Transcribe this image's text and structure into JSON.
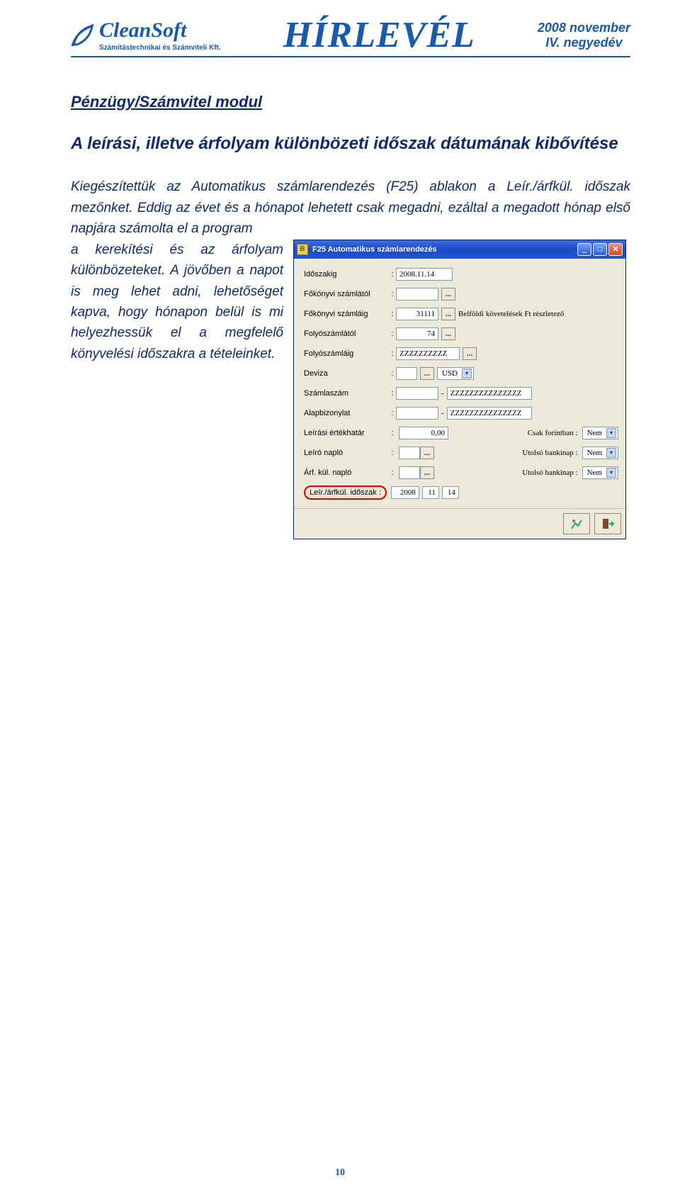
{
  "header": {
    "brand_name": "CleanSoft",
    "brand_sub": "Számítástechnikai és Számviteli Kft.",
    "newsletter_title": "HÍRLEVÉL",
    "date_line1": "2008 november",
    "date_line2": "IV. negyedév"
  },
  "module_title": "Pénzügy/Számvitel modul",
  "article_title": "A leírási, illetve árfolyam különbözeti időszak dátumának kibővítése",
  "paragraph_lead": "Kiegészítettük az ",
  "paragraph_em1": "Automatikus számlarendezés (F25)",
  "paragraph_mid1": " ablakon a ",
  "paragraph_em2": "Leír./árfkül. időszak",
  "paragraph_mid2": " mezőnket. Eddig az évet és a hónapot lehetett csak megadni, ezáltal a megadott hónap első napjára számolta el a program",
  "paragraph_left_tail": "a kerekítési és az árfolyam különbözeteket. A jövőben a napot is meg lehet adni, lehetőséget kapva, hogy hónapon belül is mi helyezhessük el a megfelelő könyvelési időszakra a tételeinket.",
  "dialog": {
    "title": "F25 Automatikus számlarendezés",
    "rows": {
      "idoszakig": {
        "label": "Időszakig",
        "value": "2008.11.14"
      },
      "fokonyvi_tol": {
        "label": "Főkönyvi számlától",
        "value": ""
      },
      "fokonyvi_ig": {
        "label": "Főkönyvi számláig",
        "value": "31111",
        "note": "Belföldi követelések Ft részletező"
      },
      "folyo_tol": {
        "label": "Folyószámlától",
        "value": "74"
      },
      "folyo_ig": {
        "label": "Folyószámláig",
        "value": "ZZZZZZZZZZ"
      },
      "deviza": {
        "label": "Deviza",
        "value": "USD"
      },
      "szamlaszam": {
        "label": "Számlaszám",
        "value": "ZZZZZZZZZZZZZZZ"
      },
      "alapbizonylat": {
        "label": "Alapbizonylat",
        "value": "ZZZZZZZZZZZZZZZ"
      },
      "ertekhatar": {
        "label": "Leírási értékhatár",
        "value": "0,00"
      },
      "csak_forint": {
        "label": "Csak forintban :",
        "value": "Nem"
      },
      "leiro_naplo": {
        "label": "Leíró napló",
        "value": ""
      },
      "utolso_bank1": {
        "label": "Utolsó bankinap :",
        "value": "Nem"
      },
      "arfkul_naplo": {
        "label": "Árf. kül. napló",
        "value": ""
      },
      "utolso_bank2": {
        "label": "Utolsó bankinap :",
        "value": "Nem"
      },
      "idoszak": {
        "label": "Leír./árfkül. időszak :",
        "year": "2008",
        "month": "11",
        "day": "14"
      }
    }
  },
  "page_number": "10",
  "glyphs": {
    "dash": "-",
    "dots": "..."
  }
}
